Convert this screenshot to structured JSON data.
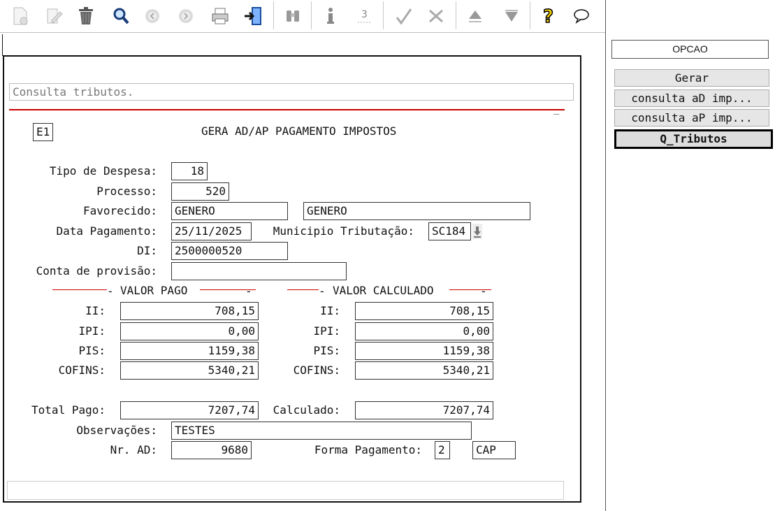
{
  "toolbar": {
    "icons": [
      "new-doc-icon",
      "edit-icon",
      "trash-icon",
      "search-icon",
      "prev-icon",
      "next-icon",
      "print-icon",
      "exit-icon",
      "binoculars-icon",
      "info-icon",
      "sum-icon",
      "check-icon",
      "cancel-icon",
      "up-icon",
      "down-icon",
      "help-icon",
      "chat-icon"
    ]
  },
  "message": {
    "text": "Consulta tributos."
  },
  "form": {
    "company_code": "E1",
    "title": "GERA AD/AP PAGAMENTO IMPOSTOS",
    "tipo_despesa": {
      "label": "Tipo de Despesa:",
      "value": "18"
    },
    "processo": {
      "label": "Processo:",
      "value": "520"
    },
    "favorecido": {
      "label": "Favorecido:",
      "value1": "GENERO",
      "value2": "GENERO"
    },
    "data_pagamento": {
      "label": "Data Pagamento:",
      "value": "25/11/2025"
    },
    "municipio": {
      "label": "Municipio Tributação:",
      "value": "SC184"
    },
    "di": {
      "label": "DI:",
      "value": "2500000520"
    },
    "conta_provisao": {
      "label": "Conta de provisão:",
      "value": ""
    },
    "valor_pago": {
      "title": "VALOR PAGO",
      "ii": {
        "label": "II:",
        "value": "708,15"
      },
      "ipi": {
        "label": "IPI:",
        "value": "0,00"
      },
      "pis": {
        "label": "PIS:",
        "value": "1159,38"
      },
      "cofins": {
        "label": "COFINS:",
        "value": "5340,21"
      }
    },
    "valor_calculado": {
      "title": "VALOR CALCULADO",
      "ii": {
        "label": "II:",
        "value": "708,15"
      },
      "ipi": {
        "label": "IPI:",
        "value": "0,00"
      },
      "pis": {
        "label": "PIS:",
        "value": "1159,38"
      },
      "cofins": {
        "label": "COFINS:",
        "value": "5340,21"
      }
    },
    "total_pago": {
      "label": "Total Pago:",
      "value": "7207,74"
    },
    "calculado": {
      "label": "Calculado:",
      "value": "7207,74"
    },
    "observacoes": {
      "label": "Observações:",
      "value": "TESTES"
    },
    "nr_ad": {
      "label": "Nr. AD:",
      "value": "9680"
    },
    "forma_pagamento": {
      "label": "Forma Pagamento:",
      "code": "2",
      "desc": "CAP"
    }
  },
  "side": {
    "header": "OPCAO",
    "buttons": [
      "Gerar",
      "consulta aD imp...",
      "consulta aP imp...",
      "Q_Tributos"
    ]
  },
  "colors": {
    "accent_line": "#cc0000",
    "selected_border": "#000000"
  }
}
